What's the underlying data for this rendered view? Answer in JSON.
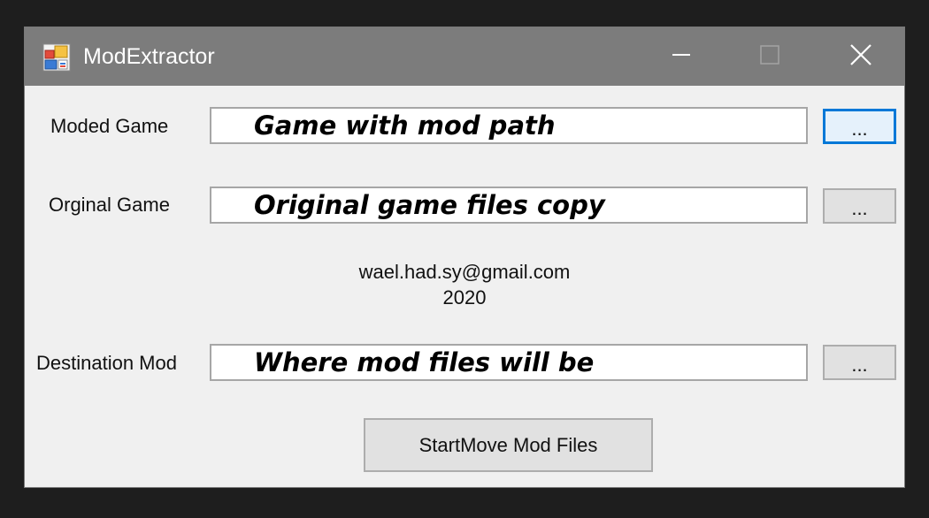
{
  "window": {
    "title": "ModExtractor",
    "titlebar_color": "#7c7c7c",
    "controls": {
      "minimize": "minimize-icon",
      "maximize": "maximize-icon",
      "close": "close-icon"
    }
  },
  "form": {
    "moded_game": {
      "label": "Moded Game",
      "value": "Game with mod path",
      "browse_label": "..."
    },
    "original_game": {
      "label": "Orginal Game",
      "value": "Original game files copy",
      "browse_label": "..."
    },
    "info": {
      "email": "wael.had.sy@gmail.com",
      "year": "2020"
    },
    "destination_mod": {
      "label": "Destination Mod",
      "value": "Where mod files will be",
      "browse_label": "..."
    },
    "start_button_label": "StartMove Mod Files"
  },
  "colors": {
    "focus_border": "#0078d7",
    "window_bg": "#f0f0f0",
    "button_bg": "#e1e1e1"
  }
}
